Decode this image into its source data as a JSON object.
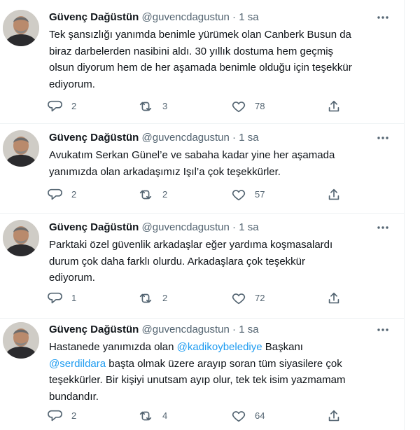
{
  "tweets": [
    {
      "name": "Güvenç Dağüstün",
      "handle": "@guvencdagustun",
      "sep": "·",
      "time": "1 sa",
      "lines": [
        "Tek şansızlığı yanımda benimle yürümek olan Canberk Busun da",
        "biraz darbelerden nasibini aldı. 30 yıllık dostuma hem geçmiş",
        "olsun diyorum hem de her aşamada benimle olduğu için teşekkür",
        "ediyorum."
      ],
      "replies": "2",
      "retweets": "3",
      "likes": "78"
    },
    {
      "name": "Güvenç Dağüstün",
      "handle": "@guvencdagustun",
      "sep": "·",
      "time": "1 sa",
      "lines": [
        "Avukatım Serkan Günel’e ve sabaha kadar yine her aşamada",
        "yanımızda olan arkadaşımız Işıl’a çok teşekkürler."
      ],
      "replies": "2",
      "retweets": "2",
      "likes": "57"
    },
    {
      "name": "Güvenç Dağüstün",
      "handle": "@guvencdagustun",
      "sep": "·",
      "time": "1 sa",
      "lines": [
        "Parktaki özel güvenlik arkadaşlar eğer yardıma koşmasalardı",
        "durum çok daha farklı olurdu. Arkadaşlara çok teşekkür",
        "ediyorum."
      ],
      "replies": "1",
      "retweets": "2",
      "likes": "72"
    },
    {
      "name": "Güvenç Dağüstün",
      "handle": "@guvencdagustun",
      "sep": "·",
      "time": "1 sa",
      "line1_pre": "Hastanede yanımızda olan ",
      "mention1": "@kadikoybelediye",
      "line1_post": " Başkanı",
      "mention2": "@serdildara",
      "line2_post": " başta olmak üzere arayıp soran tüm siyasilere çok",
      "lines": [
        "teşekkürler. Bir kişiyi unutsam ayıp olur, tek tek isim yazmamam",
        "bundandır."
      ],
      "replies": "2",
      "retweets": "4",
      "likes": "64"
    }
  ],
  "icons": {
    "reply": "reply-icon",
    "retweet": "retweet-icon",
    "like": "like-icon",
    "share": "share-icon",
    "more": "more-icon"
  },
  "colors": {
    "text": "#0f1419",
    "muted": "#536471",
    "mention": "#1d9bf0",
    "divider": "#eff3f4"
  }
}
